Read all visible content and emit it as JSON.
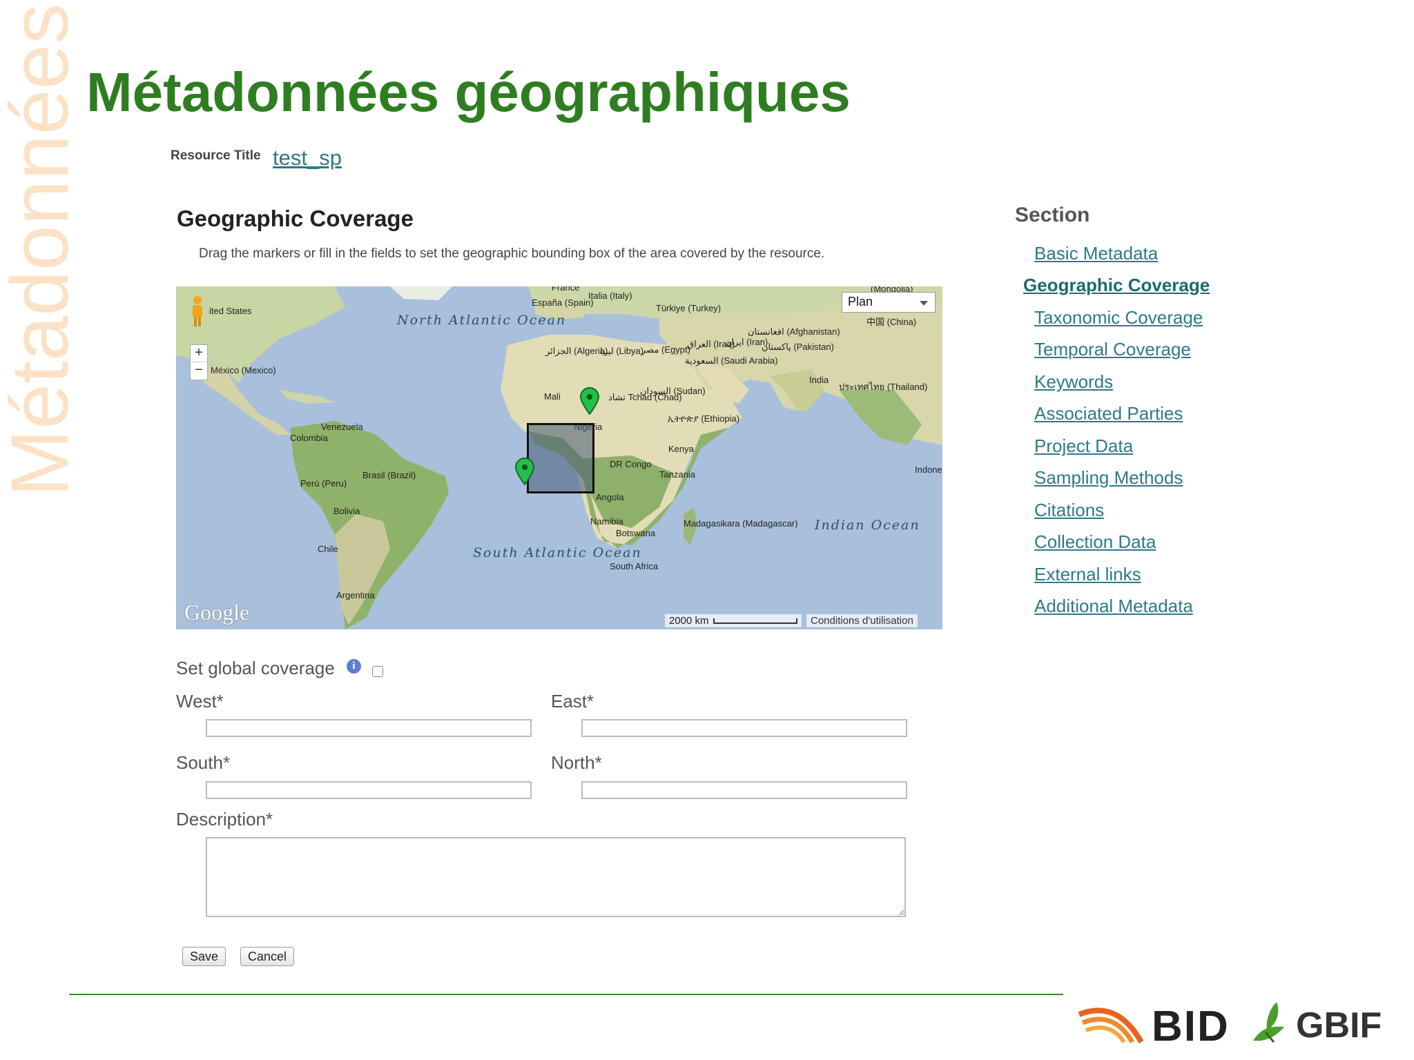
{
  "slide": {
    "title": "Métadonnées géographiques",
    "side_title": "Métadonnées"
  },
  "resource": {
    "label": "Resource Title",
    "value": "test_sp"
  },
  "geo": {
    "title": "Geographic Coverage",
    "description": "Drag the markers or fill in the fields to set the geographic bounding box of the area covered by the resource.",
    "global_label": "Set global coverage",
    "west_label": "West*",
    "east_label": "East*",
    "south_label": "South*",
    "north_label": "North*",
    "description_label": "Description*",
    "save": "Save",
    "cancel": "Cancel"
  },
  "map": {
    "type_select": "Plan",
    "google": "Google",
    "scale": "2000 km",
    "terms": "Conditions d'utilisation",
    "labels": {
      "united_states": "ited States",
      "north_atlantic": "North Atlantic Ocean",
      "mexico": "México (Mexico)",
      "venezuela": "Venezuela",
      "colombia": "Colombia",
      "peru": "Perú (Peru)",
      "brasil": "Brasil (Brazil)",
      "bolivia": "Bolivia",
      "chile": "Chile",
      "argentina": "Argentina",
      "south_atlantic": "South Atlantic Ocean",
      "france": "France",
      "espana": "España (Spain)",
      "italia": "Italia (Italy)",
      "turkiye": "Türkiye (Turkey)",
      "algeria": "الجزائر (Algeria)",
      "libya": "ليبيا (Libya)",
      "egypt": "مصر (Egypt)",
      "iraq": "العراق (Iraq)",
      "iran": "ایران (Iran)",
      "afghanistan": "افغانستان (Afghanistan)",
      "pakistan": "پاکستان (Pakistan)",
      "saudi": "السعودية (Saudi Arabia)",
      "mali": "Mali",
      "nigeria": "Nigeria",
      "chad": "تشاد Tchad (Chad)",
      "sudan": "السودان (Sudan)",
      "ethiopia": "ኢትዮጵያ (Ethiopia)",
      "drcongo": "DR Congo",
      "kenya": "Kenya",
      "tanzania": "Tanzania",
      "angola": "Angola",
      "namibia": "Namibia",
      "botswana": "Botswana",
      "madagascar": "Madagasikara (Madagascar)",
      "south_africa": "South Africa",
      "india": "India",
      "indian_ocean": "Indian Ocean",
      "china": "中国 (China)",
      "thailand": "ประเทศไทย (Thailand)",
      "mongolia": "(Mongolia)",
      "indonesia": "Indone"
    }
  },
  "sidebar": {
    "heading": "Section",
    "items": [
      {
        "label": "Basic Metadata",
        "active": false
      },
      {
        "label": "Geographic Coverage",
        "active": true
      },
      {
        "label": "Taxonomic Coverage",
        "active": false
      },
      {
        "label": "Temporal Coverage",
        "active": false
      },
      {
        "label": "Keywords",
        "active": false
      },
      {
        "label": "Associated Parties",
        "active": false
      },
      {
        "label": "Project Data",
        "active": false
      },
      {
        "label": "Sampling Methods",
        "active": false
      },
      {
        "label": "Citations",
        "active": false
      },
      {
        "label": "Collection Data",
        "active": false
      },
      {
        "label": "External links",
        "active": false
      },
      {
        "label": "Additional Metadata",
        "active": false
      }
    ]
  },
  "logos": {
    "bid": "BID",
    "gbif": "GBIF"
  },
  "colors": {
    "title_green": "#2e7d21",
    "link_teal": "#2b7a88",
    "watermark": "#fbe2c6",
    "marker_green": "#22c04a"
  }
}
